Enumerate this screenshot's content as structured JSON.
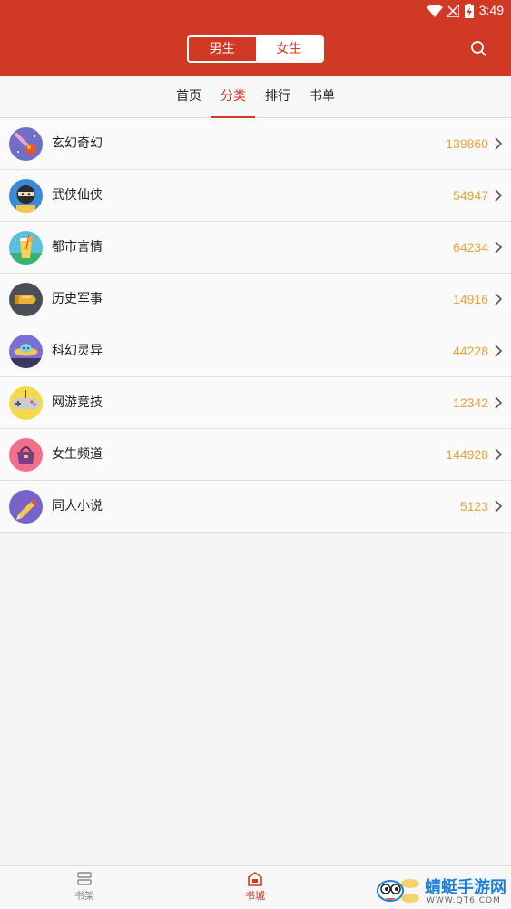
{
  "status_bar": {
    "time": "3:49"
  },
  "header": {
    "segment": [
      {
        "label": "男生",
        "active": false
      },
      {
        "label": "女生",
        "active": true
      }
    ],
    "search_icon": "search-icon"
  },
  "tabs": [
    {
      "label": "首页",
      "active": false
    },
    {
      "label": "分类",
      "active": true
    },
    {
      "label": "排行",
      "active": false
    },
    {
      "label": "书单",
      "active": false
    }
  ],
  "categories": [
    {
      "name": "玄幻奇幻",
      "count": "139860",
      "icon": "meteor-icon"
    },
    {
      "name": "武侠仙侠",
      "count": "54947",
      "icon": "ninja-icon"
    },
    {
      "name": "都市言情",
      "count": "64234",
      "icon": "drink-icon"
    },
    {
      "name": "历史军事",
      "count": "14916",
      "icon": "bullet-icon"
    },
    {
      "name": "科幻灵异",
      "count": "44228",
      "icon": "ufo-icon"
    },
    {
      "name": "网游竞技",
      "count": "12342",
      "icon": "gamepad-icon"
    },
    {
      "name": "女生频道",
      "count": "144928",
      "icon": "handbag-icon"
    },
    {
      "name": "同人小说",
      "count": "5123",
      "icon": "pencil-icon"
    }
  ],
  "bottom_nav": [
    {
      "label": "书架",
      "active": false
    },
    {
      "label": "书城",
      "active": true
    }
  ],
  "watermark": {
    "text": "蜻蜓手游网",
    "url": "WWW.QT6.COM"
  },
  "colors": {
    "brand": "#d03a25",
    "count": "#e8a23a"
  }
}
